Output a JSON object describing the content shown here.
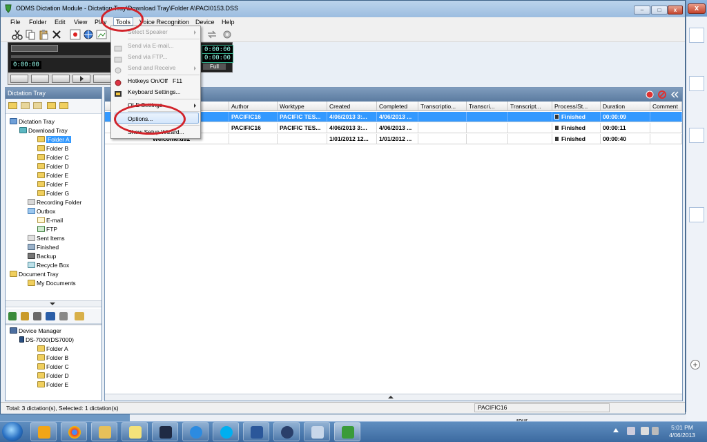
{
  "window": {
    "title": "ODMS Dictation Module - Dictation Tray\\Download Tray\\Folder A\\PACI0153.DSS"
  },
  "menu": [
    "File",
    "Folder",
    "Edit",
    "View",
    "Play",
    "Tools",
    "Voice Recognition",
    "Device",
    "Help"
  ],
  "player": {
    "position": "0:00:00",
    "time_1": "0:00:00",
    "time_2": "0:00:00",
    "mode": "Full"
  },
  "left_panel": {
    "header": "Dictation Tray"
  },
  "tree": [
    {
      "label": "Dictation Tray",
      "level": 0
    },
    {
      "label": "Download Tray",
      "level": 1
    },
    {
      "label": "Folder A",
      "level": 2,
      "selected": true
    },
    {
      "label": "Folder B",
      "level": 2
    },
    {
      "label": "Folder C",
      "level": 2
    },
    {
      "label": "Folder D",
      "level": 2
    },
    {
      "label": "Folder E",
      "level": 2
    },
    {
      "label": "Folder F",
      "level": 2
    },
    {
      "label": "Folder G",
      "level": 2
    },
    {
      "label": "Recording Folder",
      "level": 1
    },
    {
      "label": "Outbox",
      "level": 1
    },
    {
      "label": "E-mail",
      "level": 2
    },
    {
      "label": "FTP",
      "level": 2
    },
    {
      "label": "Sent Items",
      "level": 1
    },
    {
      "label": "Finished",
      "level": 1
    },
    {
      "label": "Backup",
      "level": 1
    },
    {
      "label": "Recycle Box",
      "level": 1
    },
    {
      "label": "Document Tray",
      "level": 0
    },
    {
      "label": "My Documents",
      "level": 1
    }
  ],
  "device_tree": [
    {
      "label": "Device Manager",
      "level": 0
    },
    {
      "label": "DS-7000(DS7000)",
      "level": 1
    },
    {
      "label": "Folder A",
      "level": 2
    },
    {
      "label": "Folder B",
      "level": 2
    },
    {
      "label": "Folder C",
      "level": 2
    },
    {
      "label": "Folder D",
      "level": 2
    },
    {
      "label": "Folder E",
      "level": 2
    }
  ],
  "columns": [
    "",
    "",
    "",
    "File Name",
    "Author",
    "Worktype",
    "Created",
    "Completed",
    "Transcriptio...",
    "Transcri...",
    "Transcript...",
    "Process/St...",
    "Duration",
    "Comment"
  ],
  "rows": [
    {
      "name": "PACI0153...",
      "author": "PACIFIC16",
      "worktype": "PACIFIC TES...",
      "created": "4/06/2013 3:...",
      "completed": "4/06/2013 ...",
      "status": "Finished",
      "duration": "00:00:09",
      "selected": true
    },
    {
      "name": "PACI0154...",
      "author": "PACIFIC16",
      "worktype": "PACIFIC TES...",
      "created": "4/06/2013 3:...",
      "completed": "4/06/2013 ...",
      "status": "Finished",
      "duration": "00:00:11",
      "selected": false
    },
    {
      "name": "Welcome.ds2",
      "author": "",
      "worktype": "",
      "created": "1/01/2012 12...",
      "completed": "1/01/2012 ...",
      "status": "Finished",
      "duration": "00:00:40",
      "selected": false
    }
  ],
  "tools_menu": [
    {
      "label": "Select Speaker",
      "disabled": true,
      "submenu": true
    },
    {
      "label": "Send via E-mail...",
      "disabled": true
    },
    {
      "label": "Send via FTP...",
      "disabled": true
    },
    {
      "label": "Send and Receive",
      "disabled": true,
      "submenu": true
    },
    {
      "label": "Hotkeys On/Off",
      "shortcut": "F11"
    },
    {
      "label": "Keyboard Settings..."
    },
    {
      "label": "OLE Settings",
      "submenu": true
    },
    {
      "label": "Options...",
      "highlighted": true
    },
    {
      "label": "Show Setup Wizard..."
    }
  ],
  "status": {
    "summary": "Total: 3 dictation(s), Selected: 1 dictation(s)",
    "user": "PACIFIC16"
  },
  "background_text": "rour",
  "clock": {
    "time": "5:01 PM",
    "date": "4/06/2013"
  },
  "colors": {
    "selection": "#3399ff",
    "annotation": "#d2232a",
    "panel_header": "#6b8bb0",
    "taskbar": "#4a78ab"
  }
}
